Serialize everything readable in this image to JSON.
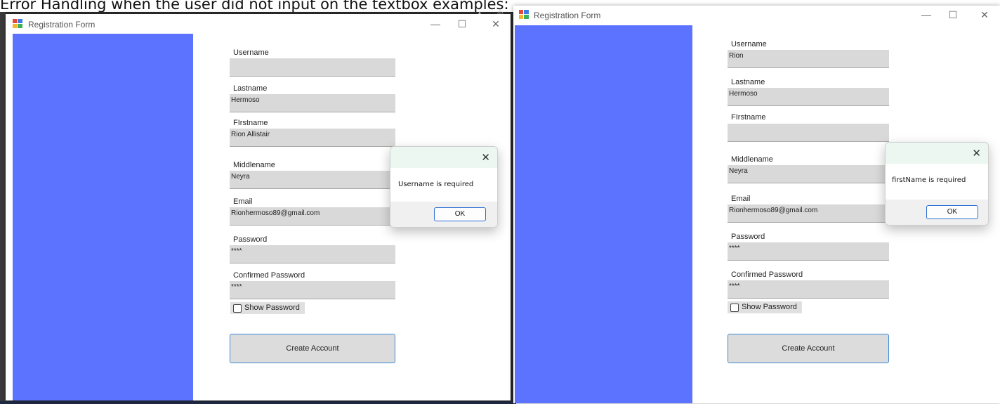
{
  "caption": "Error Handling when the user did not input on the textbox examples:",
  "colors": {
    "panel_blue": "#5b73ff",
    "textbox_gray": "#d9d9d9",
    "dialog_header": "#ebf7f0",
    "ok_border": "#2f6fd6"
  },
  "icons": {
    "app": "registration-form-app-icon",
    "minimize": "minimize-icon",
    "maximize": "maximize-icon",
    "close": "close-icon"
  },
  "window_controls": {
    "minimize": "—",
    "maximize": "☐",
    "close": "✕"
  },
  "windows": [
    {
      "title": "Registration Form",
      "fields": [
        {
          "label": "Username",
          "value": ""
        },
        {
          "label": "Lastname",
          "value": "Hermoso"
        },
        {
          "label": "FIrstname",
          "value": "Rion Allistair"
        },
        {
          "label": "Middlename",
          "value": "Neyra"
        },
        {
          "label": "Email",
          "value": "Rionhermoso89@gmail.com"
        },
        {
          "label": "Password",
          "value": "****"
        },
        {
          "label": "Confirmed Password",
          "value": "****"
        }
      ],
      "show_password": {
        "label": "Show Password",
        "checked": false
      },
      "create_account": "Create Account",
      "dialog": {
        "message": "Username is required",
        "ok": "OK",
        "close": "✕"
      }
    },
    {
      "title": "Registration Form",
      "fields": [
        {
          "label": "Username",
          "value": "Rion"
        },
        {
          "label": "Lastname",
          "value": "Hermoso"
        },
        {
          "label": "FIrstname",
          "value": ""
        },
        {
          "label": "Middlename",
          "value": "Neyra"
        },
        {
          "label": "Email",
          "value": "Rionhermoso89@gmail.com"
        },
        {
          "label": "Password",
          "value": "****"
        },
        {
          "label": "Confirmed Password",
          "value": "****"
        }
      ],
      "show_password": {
        "label": "Show Password",
        "checked": false
      },
      "create_account": "Create Account",
      "dialog": {
        "message": "firstName is required",
        "ok": "OK",
        "close": "✕"
      }
    }
  ]
}
